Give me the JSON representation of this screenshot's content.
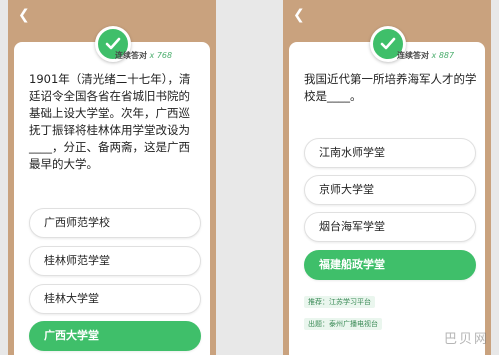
{
  "left": {
    "streak_label": "连续答对",
    "streak_count": "x 768",
    "question": "1901年（清光绪二十七年），清廷诏令全国各省在省城旧书院的基础上设大学堂。次年，广西巡抚丁振铎将桂林体用学堂改设为____，分正、备两斋，这是广西最早的大学。",
    "options": [
      "广西师范学校",
      "桂林师范学堂",
      "桂林大学堂",
      "广西大学堂"
    ],
    "correct_index": 3
  },
  "right": {
    "streak_label": "连续答对",
    "streak_count": "x 887",
    "question": "我国近代第一所培养海军人才的学校是____。",
    "options": [
      "江南水师学堂",
      "京师大学堂",
      "烟台海军学堂",
      "福建船政学堂"
    ],
    "correct_index": 3,
    "recommend": "推荐：江苏学习平台",
    "source": "出题：泰州广播电视台"
  },
  "icons": {
    "back": "back-arrow-icon",
    "check": "check-icon"
  },
  "colors": {
    "accent": "#3fbf6a",
    "background": "#c9a27e"
  },
  "watermark": "巴贝网"
}
